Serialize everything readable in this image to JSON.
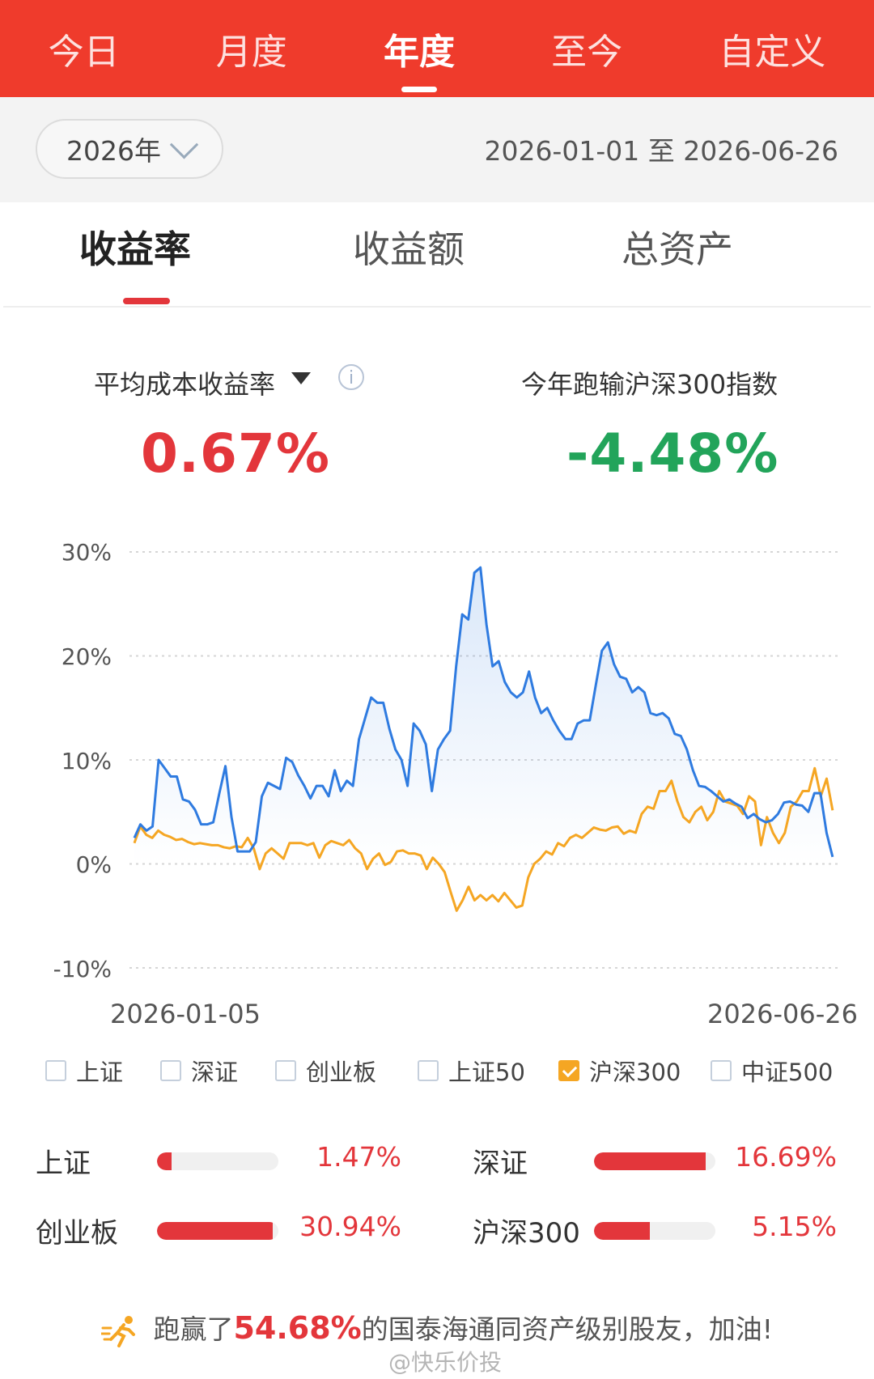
{
  "tabs": [
    "今日",
    "月度",
    "年度",
    "至今",
    "自定义"
  ],
  "active_tab": "年度",
  "year_select": "2026年",
  "date_range": "2026-01-01 至 2026-06-26",
  "metric_tabs": [
    "收益率",
    "收益额",
    "总资产"
  ],
  "kpi": {
    "left_label": "平均成本收益率",
    "left_value": "0.67%",
    "right_label": "今年跑输沪深300指数",
    "right_value": "-4.48%"
  },
  "colors": {
    "brand_red": "#ef3b2c",
    "positive": "#e3363b",
    "negative": "#22a45a",
    "series_portfolio": "#2f7be0",
    "series_benchmark": "#f5a623"
  },
  "chart_data": {
    "type": "line",
    "x_start_label": "2026-01-05",
    "x_end_label": "2026-06-26",
    "ylim": [
      -10,
      30
    ],
    "yticks": [
      "30%",
      "20%",
      "10%",
      "0%",
      "-10%"
    ],
    "grid": true,
    "series": [
      {
        "name": "",
        "values": [
          2.5,
          3.8,
          3.2,
          3.6,
          10,
          9.2,
          8.4,
          8.4,
          6.2,
          6,
          5.2,
          3.8,
          3.8,
          4,
          6.8,
          9.4,
          4.5,
          1.2,
          1.2,
          1.2,
          2.1,
          6.5,
          7.8,
          7.5,
          7.2,
          10.2,
          9.8,
          8.5,
          7.5,
          6.3,
          7.5,
          7.5,
          6.5,
          9,
          7,
          8,
          7.5,
          12,
          14,
          16,
          15.5,
          15.5,
          13,
          11,
          10,
          7.5,
          13.5,
          12.8,
          11.5,
          7,
          11,
          12,
          12.8,
          19,
          24,
          23.5,
          28,
          28.5,
          23,
          19,
          19.5,
          17.5,
          16.5,
          16,
          16.5,
          18.5,
          16,
          14.5,
          15,
          13.8,
          12.8,
          12,
          12,
          13.5,
          13.8,
          13.8,
          17.2,
          20.5,
          21.3,
          19.2,
          18,
          17.8,
          16.5,
          17,
          16.5,
          14.5,
          14.3,
          14.5,
          14,
          12.5,
          12.3,
          11,
          9,
          7.5,
          7.4,
          7,
          6.5,
          6,
          6.2,
          5.8,
          5.5,
          4.4,
          4.8,
          4.3,
          4,
          4.2,
          4.8,
          5.9,
          6,
          5.7,
          5.6,
          5,
          6.8,
          6.8,
          3,
          0.67
        ]
      },
      {
        "name": "沪深300",
        "values": [
          2,
          3.6,
          2.8,
          2.5,
          3.2,
          2.8,
          2.6,
          2.3,
          2.4,
          2.1,
          1.9,
          2,
          1.9,
          1.8,
          1.8,
          1.6,
          1.5,
          1.7,
          1.6,
          2.5,
          1.5,
          -0.5,
          1,
          1.5,
          1,
          0.5,
          2,
          2,
          2,
          1.8,
          2,
          0.6,
          1.8,
          2.2,
          2,
          1.8,
          2.3,
          1.5,
          1,
          -0.5,
          0.5,
          1,
          -0.1,
          0.2,
          1.2,
          1.3,
          1,
          1,
          0.8,
          -0.5,
          0.6,
          0,
          -0.8,
          -2.7,
          -4.5,
          -3.5,
          -2.2,
          -3.5,
          -3,
          -3.5,
          -3,
          -3.6,
          -2.8,
          -3.5,
          -4.2,
          -4,
          -1.3,
          0,
          0.5,
          1.2,
          0.9,
          2,
          1.7,
          2.5,
          2.8,
          2.5,
          3,
          3.5,
          3.3,
          3.2,
          3.5,
          3.6,
          2.9,
          3.2,
          3,
          4.8,
          5.5,
          5.3,
          7,
          7,
          8,
          6,
          4.5,
          4,
          5,
          5.5,
          4.2,
          5,
          7,
          6,
          5.8,
          5.6,
          4.8,
          6.5,
          6,
          1.8,
          4.5,
          3,
          2,
          3,
          5.5,
          6,
          7,
          7,
          9.2,
          6.5,
          8.2,
          5.15
        ]
      }
    ]
  },
  "legend": [
    {
      "label": "上证",
      "checked": false
    },
    {
      "label": "深证",
      "checked": false
    },
    {
      "label": "创业板",
      "checked": false
    },
    {
      "label": "上证50",
      "checked": false
    },
    {
      "label": "沪深300",
      "checked": true
    },
    {
      "label": "中证500",
      "checked": false
    }
  ],
  "comparisons": [
    {
      "label": "上证",
      "value": "1.47%",
      "fill": 0.12
    },
    {
      "label": "深证",
      "value": "16.69%",
      "fill": 0.92
    },
    {
      "label": "创业板",
      "value": "30.94%",
      "fill": 0.95
    },
    {
      "label": "沪深300",
      "value": "5.15%",
      "fill": 0.46
    }
  ],
  "footer": {
    "prefix": "跑赢了",
    "highlight": "54.68%",
    "suffix": "的国泰海通同资产级别股友，加油!"
  },
  "watermark": "@快乐价投"
}
